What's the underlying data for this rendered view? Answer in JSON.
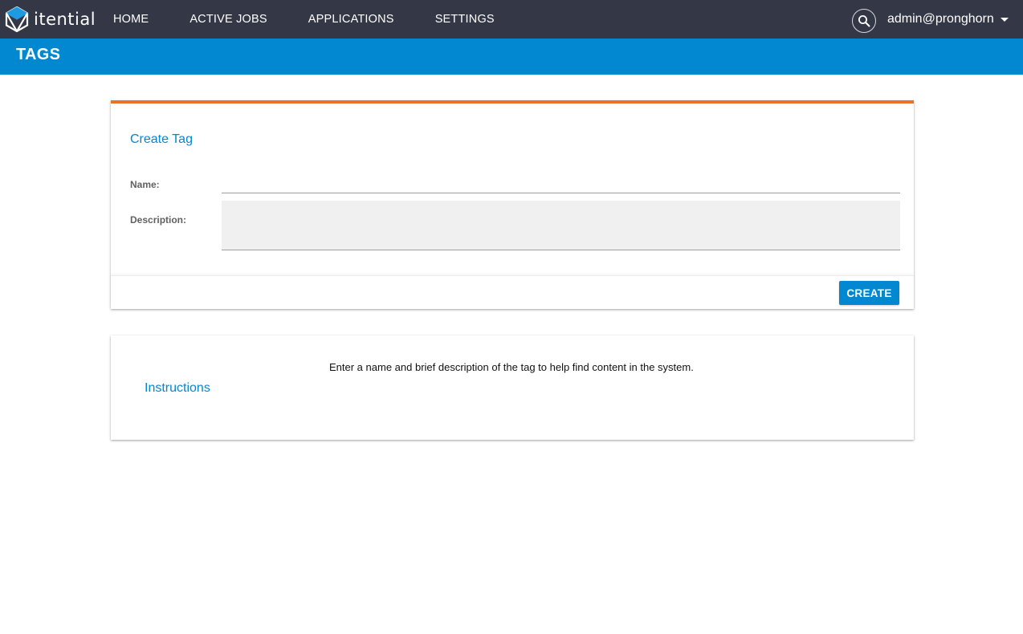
{
  "brand": {
    "logo_text": "itential",
    "accent_color": "#0288d1",
    "navbar_color": "#343746",
    "card_accent_color": "#e8712c"
  },
  "nav": {
    "items": [
      {
        "label": "HOME"
      },
      {
        "label": "ACTIVE JOBS"
      },
      {
        "label": "APPLICATIONS"
      },
      {
        "label": "SETTINGS"
      }
    ],
    "search_icon": "search-icon",
    "user": "admin@pronghorn"
  },
  "page": {
    "title": "TAGS"
  },
  "create_card": {
    "heading": "Create Tag",
    "name_label": "Name:",
    "name_value": "",
    "description_label": "Description:",
    "description_value": "",
    "create_label": "CREATE"
  },
  "instructions_card": {
    "heading": "Instructions",
    "text": "Enter a name and brief description of the tag to help find content in the system."
  }
}
